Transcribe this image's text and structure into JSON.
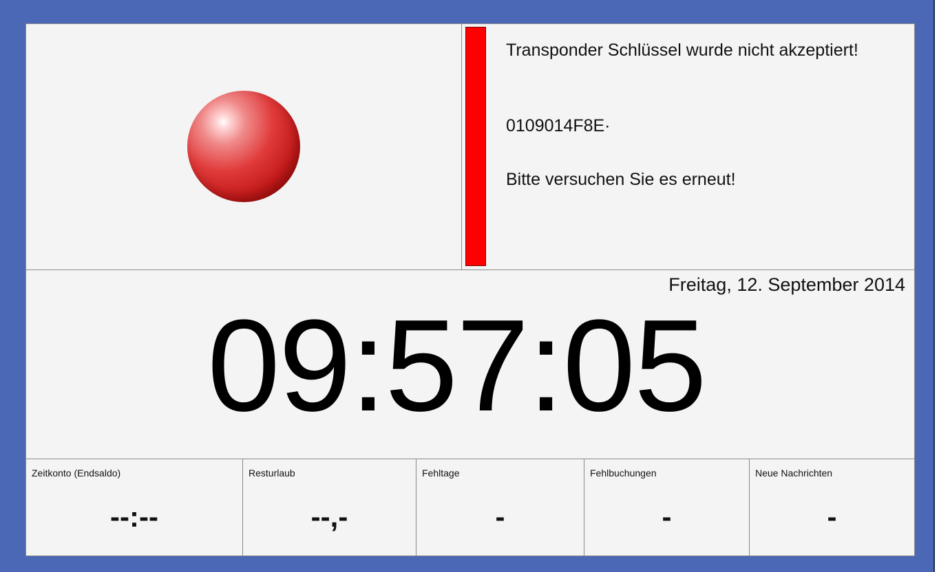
{
  "message": {
    "title": "Transponder Schlüssel wurde nicht akzeptiert!",
    "code": "0109014F8E·",
    "hint": "Bitte versuchen Sie es erneut!"
  },
  "status": {
    "indicator_color": "#d42020",
    "bar_color": "#ff0000"
  },
  "clock": {
    "date": "Freitag, 12. September 2014",
    "time": "09:57:05"
  },
  "stats": [
    {
      "label": "Zeitkonto (Endsaldo)",
      "value": "--:--"
    },
    {
      "label": "Resturlaub",
      "value": "--,-"
    },
    {
      "label": "Fehltage",
      "value": "-"
    },
    {
      "label": "Fehlbuchungen",
      "value": "-"
    },
    {
      "label": "Neue Nachrichten",
      "value": "-"
    }
  ],
  "colors": {
    "frame": "#4a68b5",
    "panel": "#f4f4f4"
  }
}
